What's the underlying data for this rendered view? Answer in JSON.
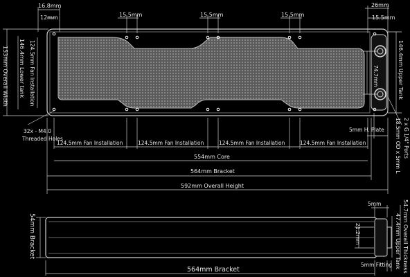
{
  "dimensions": {
    "bracket_offset": "16.8mm",
    "first_hole": "12mm",
    "hole_spacing_1": "15.5mm",
    "hole_spacing_2": "15.5mm",
    "hole_spacing_3": "15.5mm",
    "end_offset": "26mm",
    "end_hole_spacing": "15.5mm",
    "overall_width": "153mm Overall Width",
    "fan_install_left": "124.5mm Fan Installation",
    "lower_tank": "146.4mm Lower tank",
    "upper_tank": "146.4mm Upper Tank",
    "port_spacing": "74.7mm",
    "port_thread": "2 x G 1/4\" Ports",
    "tube": "18.5mm OD x 5mm L",
    "plate": "5mm H. Plate",
    "threaded_holes": "32x - M4.0\nThreaded Holes",
    "fan_1": "124.5mm Fan Installation",
    "fan_2": "124.5mm Fan Installation",
    "fan_3": "124.5mm Fan Installation",
    "fan_4": "124.5mm Fan Installation",
    "core": "554mm Core",
    "bracket": "564mm Bracket",
    "overall_height": "592mm Overall Height",
    "side_bracket": "54mm Bracket",
    "side_5mm": "5mm",
    "side_21mm": "21.2mm",
    "overall_thickness": "54.7mm Overall Thickness",
    "upper_tank_side": "47.4mm Upper Tank",
    "fitting": "5mm Fitting",
    "side_564": "564mm Bracket"
  }
}
